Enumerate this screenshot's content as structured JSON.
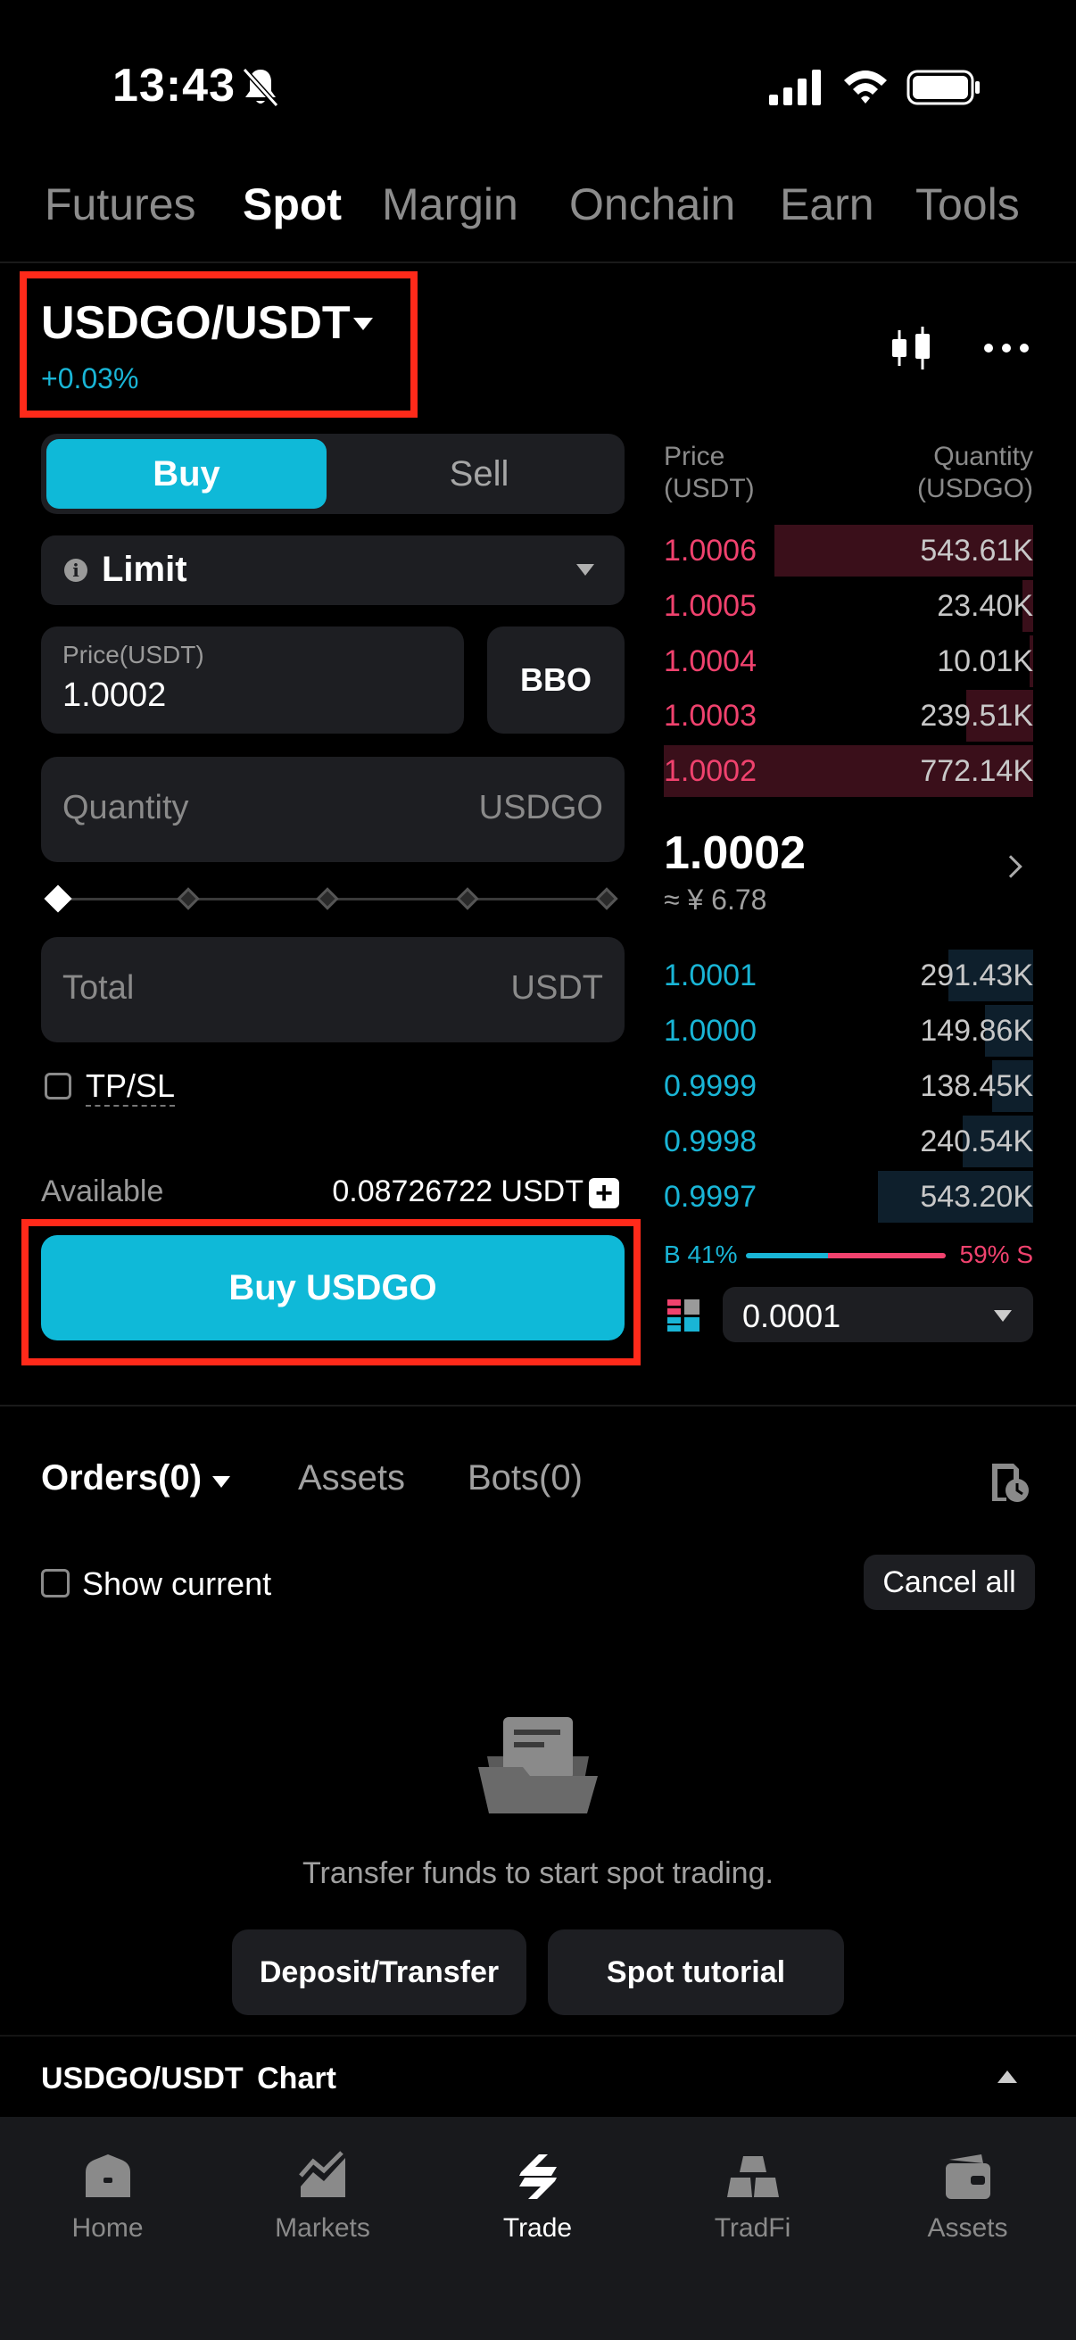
{
  "status_bar": {
    "time": "13:43"
  },
  "top_tabs": [
    {
      "label": "Futures",
      "active": false
    },
    {
      "label": "Spot",
      "active": true
    },
    {
      "label": "Margin",
      "active": false
    },
    {
      "label": "Onchain",
      "active": false
    },
    {
      "label": "Earn",
      "active": false
    },
    {
      "label": "Tools",
      "active": false
    }
  ],
  "pair": {
    "name": "USDGO/USDT",
    "change": "+0.03%"
  },
  "trade_form": {
    "buy_label": "Buy",
    "sell_label": "Sell",
    "order_type": "Limit",
    "price_label": "Price(USDT)",
    "price_value": "1.0002",
    "bbo_label": "BBO",
    "quantity_placeholder": "Quantity",
    "quantity_unit": "USDGO",
    "slider_fraction": 0,
    "total_placeholder": "Total",
    "total_unit": "USDT",
    "tpsl_label": "TP/SL",
    "available_label": "Available",
    "available_value": "0.08726722 USDT",
    "submit_label": "Buy USDGO"
  },
  "order_book": {
    "price_header": [
      "Price",
      "(USDT)"
    ],
    "qty_header": [
      "Quantity",
      "(USDGO)"
    ],
    "asks": [
      {
        "price": "1.0006",
        "qty": "543.61K",
        "depth": 0.7
      },
      {
        "price": "1.0005",
        "qty": "23.40K",
        "depth": 0.03
      },
      {
        "price": "1.0004",
        "qty": "10.01K",
        "depth": 0.01
      },
      {
        "price": "1.0003",
        "qty": "239.51K",
        "depth": 0.18
      },
      {
        "price": "1.0002",
        "qty": "772.14K",
        "depth": 1.0
      }
    ],
    "mid_price": "1.0002",
    "mid_fiat": "≈ ¥ 6.78",
    "bids": [
      {
        "price": "1.0001",
        "qty": "291.43K",
        "depth": 0.23
      },
      {
        "price": "1.0000",
        "qty": "149.86K",
        "depth": 0.13
      },
      {
        "price": "0.9999",
        "qty": "138.45K",
        "depth": 0.11
      },
      {
        "price": "0.9998",
        "qty": "240.54K",
        "depth": 0.19
      },
      {
        "price": "0.9997",
        "qty": "543.20K",
        "depth": 0.42
      }
    ],
    "buy_ratio_label": "B 41%",
    "sell_ratio_label": "59% S",
    "buy_ratio": 0.41,
    "precision": "0.0001"
  },
  "orders": {
    "tab_orders": "Orders(0)",
    "tab_assets": "Assets",
    "tab_bots": "Bots(0)",
    "show_current_label": "Show current",
    "cancel_all_label": "Cancel all",
    "empty_text": "Transfer funds to start spot trading.",
    "deposit_label": "Deposit/Transfer",
    "tutorial_label": "Spot tutorial"
  },
  "chart_bar": {
    "label": "USDGO/USDT  Chart"
  },
  "bottom_nav": [
    {
      "label": "Home",
      "icon": "home-icon",
      "active": false
    },
    {
      "label": "Markets",
      "icon": "markets-icon",
      "active": false
    },
    {
      "label": "Trade",
      "icon": "trade-icon",
      "active": true
    },
    {
      "label": "TradFi",
      "icon": "tradfi-icon",
      "active": false
    },
    {
      "label": "Assets",
      "icon": "wallet-icon",
      "active": false
    }
  ],
  "colors": {
    "accent": "#0fb9d8",
    "bid": "#19b5d6",
    "ask": "#f0426e",
    "panel": "#1d1e22",
    "highlight_box": "#ff2a1a"
  }
}
